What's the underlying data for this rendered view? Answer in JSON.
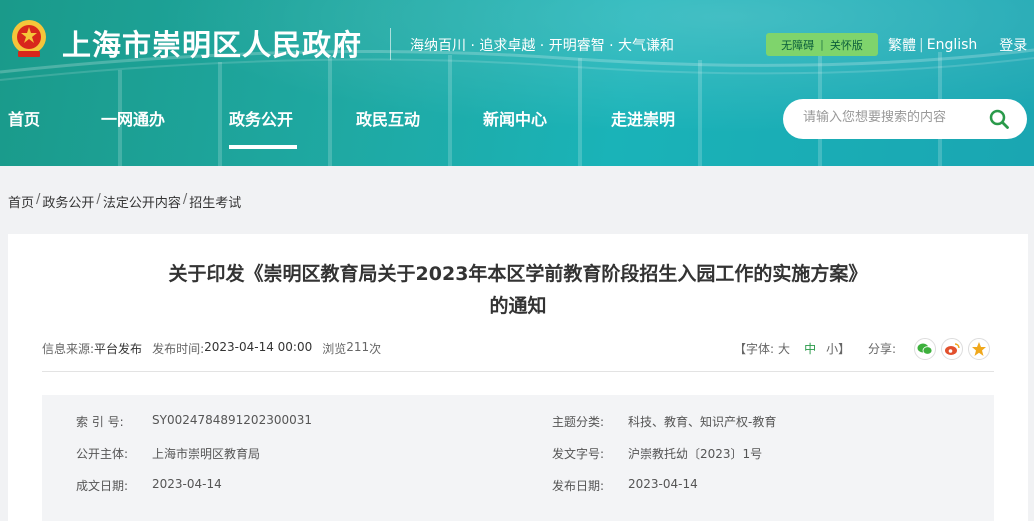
{
  "header": {
    "site_title": "上海市崇明区人民政府",
    "slogan": "海纳百川 · 追求卓越 · 开明睿智 · 大气谦和",
    "accessibility": "无障碍",
    "care_mode": "关怀版",
    "traditional": "繁體",
    "english": "English",
    "login": "登录"
  },
  "nav": {
    "items": [
      "首页",
      "一网通办",
      "政务公开",
      "政民互动",
      "新闻中心",
      "走进崇明"
    ],
    "active_index": 2
  },
  "search": {
    "placeholder": "请输入您想要搜索的内容"
  },
  "breadcrumb": [
    "首页",
    "政务公开",
    "法定公开内容",
    "招生考试"
  ],
  "article": {
    "title_line1": "关于印发《崇明区教育局关于2023年本区学前教育阶段招生入园工作的实施方案》",
    "title_line2": "的通知",
    "source_label": "信息来源:",
    "source": "平台发布",
    "date_label": "发布时间:",
    "date": "2023-04-14 00:00",
    "views_label": "浏览",
    "views": "211",
    "views_unit": "次",
    "font_label": "【字体:",
    "font_large": "大",
    "font_medium": "中",
    "font_small": "小】",
    "share_label": "分享:"
  },
  "info": {
    "index_label": "索 引 号:",
    "index_value": "SY0024784891202300031",
    "topic_label": "主题分类:",
    "topic_value": "科技、教育、知识产权-教育",
    "publisher_label": "公开主体:",
    "publisher_value": "上海市崇明区教育局",
    "doc_no_label": "发文字号:",
    "doc_no_value": "沪崇教托幼〔2023〕1号",
    "written_label": "成文日期:",
    "written_value": "2023-04-14",
    "published_label": "发布日期:",
    "published_value": "2023-04-14"
  },
  "icons": {
    "emblem": "national-emblem-icon",
    "search": "search-icon",
    "share": [
      "wechat-icon",
      "weibo-icon",
      "favorite-star-icon"
    ]
  },
  "colors": {
    "header_teal": "#1fa9a3",
    "access_green": "#7fd46c",
    "search_green": "#2a9a4a",
    "wechat": "#3db03c",
    "weibo": "#e2502d",
    "star": "#f0a81c"
  }
}
